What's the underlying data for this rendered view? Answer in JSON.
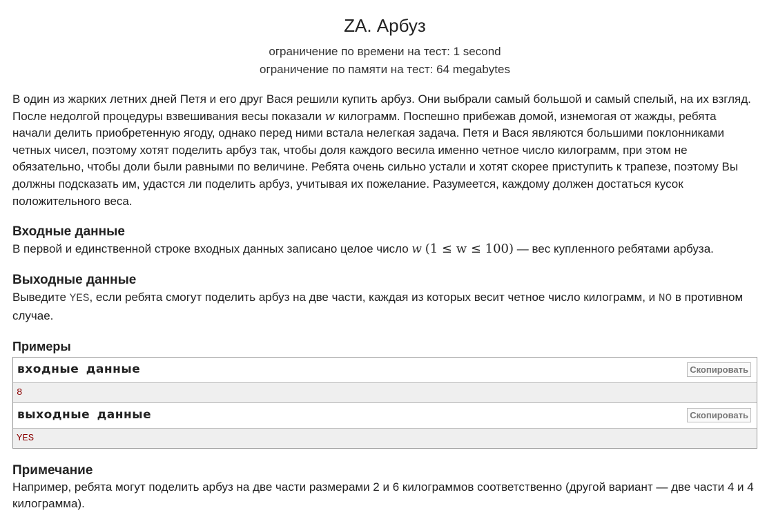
{
  "problem": {
    "title": "ZA. Арбуз",
    "time_limit": "ограничение по времени на тест: 1 second",
    "memory_limit": "ограничение по памяти на тест: 64 megabytes",
    "statement_part1": "В один из жарких летних дней Петя и его друг Вася решили купить арбуз. Они выбрали самый большой и самый спелый, на их взгляд. После недолгой процедуры взвешивания весы показали ",
    "statement_var": "w",
    "statement_part2": " килограмм. Поспешно прибежав домой, изнемогая от жажды, ребята начали делить приобретенную ягоду, однако перед ними встала нелегкая задача. Петя и Вася являются большими поклонниками четных чисел, поэтому хотят поделить арбуз так, чтобы доля каждого весила именно четное число килограмм, при этом не обязательно, чтобы доли были равными по величине. Ребята очень сильно устали и хотят скорее приступить к трапезе, поэтому Вы должны подсказать им, удастся ли поделить арбуз, учитывая их пожелание. Разумеется, каждому должен достаться кусок положительного веса."
  },
  "input_section": {
    "title": "Входные данные",
    "text_before": "В первой и единственной строке входных данных записано целое число ",
    "var": "w",
    "constraint": "(1 ≤ w ≤ 100)",
    "text_after": " — вес купленного ребятами арбуза."
  },
  "output_section": {
    "title": "Выходные данные",
    "text_before": "Выведите ",
    "yes": "YES",
    "text_middle": ", если ребята смогут поделить арбуз на две части, каждая из которых весит четное число килограмм, и ",
    "no": "NO",
    "text_after": " в противном случае."
  },
  "examples": {
    "title": "Примеры",
    "input_label": "входные данные",
    "input_value": "8",
    "output_label": "выходные данные",
    "output_value": "YES",
    "copy_label": "Скопировать"
  },
  "note": {
    "title": "Примечание",
    "text": "Например, ребята могут поделить арбуз на две части размерами 2 и 6 килограммов соответственно (другой вариант — две части 4 и 4 килограмма)."
  }
}
